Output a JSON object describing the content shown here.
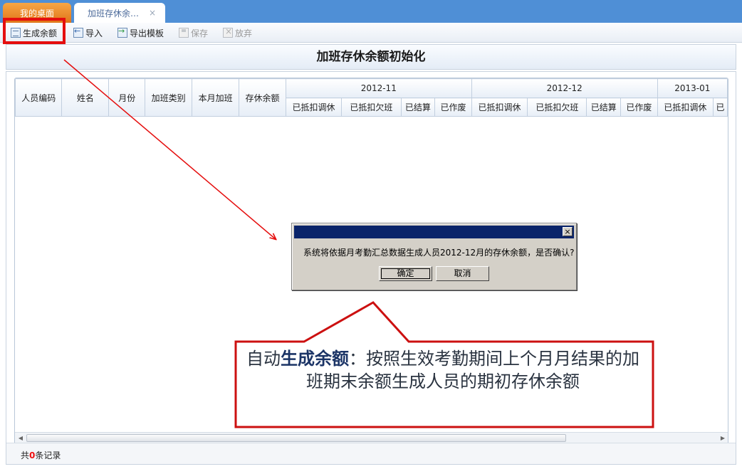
{
  "tabs": {
    "home": "我的桌面",
    "active": "加班存休余…",
    "close": "×"
  },
  "toolbar": {
    "generate": "生成余额",
    "import": "导入",
    "export_template": "导出模板",
    "save": "保存",
    "discard": "放弃"
  },
  "page_title": "加班存休余额初始化",
  "grid": {
    "fixed_columns": [
      "人员编码",
      "姓名",
      "月份",
      "加班类别",
      "本月加班",
      "存休余额"
    ],
    "months": [
      "2012-11",
      "2012-12",
      "2013-01"
    ],
    "sub_columns": [
      "已抵扣调休",
      "已抵扣欠班",
      "已结算",
      "已作废"
    ],
    "partial_next": "已"
  },
  "footer": {
    "prefix": "共",
    "count": "0",
    "suffix": "条记录"
  },
  "dialog": {
    "message": "系统将依据月考勤汇总数据生成人员2012-12月的存休余额，是否确认?",
    "ok": "确定",
    "cancel": "取消",
    "close": "×"
  },
  "callout": {
    "prefix": "自动",
    "bold": "生成余额",
    "text": "：按照生效考勤期间上个月月结果的加班期末余额生成人员的期初存休余额"
  },
  "colors": {
    "tab_bar": "#4f8fd6",
    "home_tab": "#f08a2a",
    "annotation_red": "#e50e0e",
    "dialog_title": "#0a246a"
  }
}
